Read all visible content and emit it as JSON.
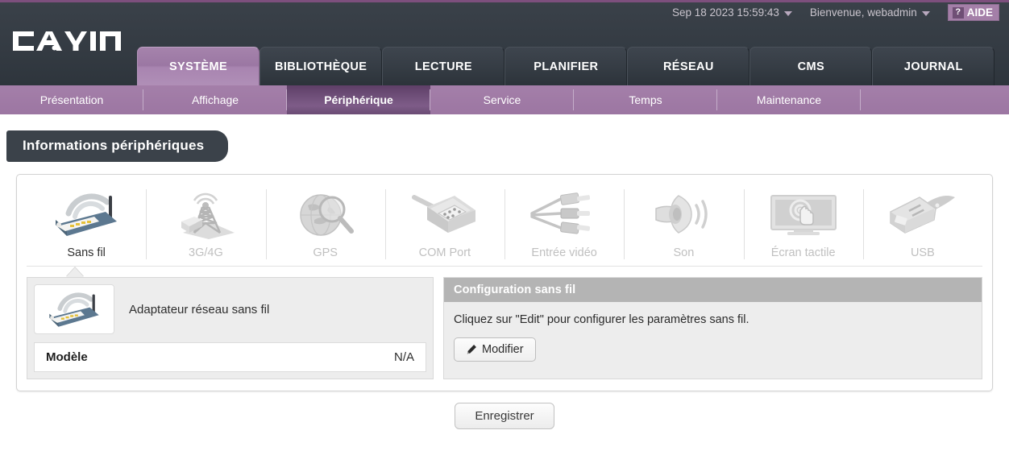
{
  "topbar": {
    "datetime": "Sep 18 2023 15:59:43",
    "welcome": "Bienvenue, webadmin",
    "help_label": "AIDE",
    "help_glyph": "?"
  },
  "brand": {
    "name": "CAYIN"
  },
  "main_tabs": [
    {
      "label": "SYSTÈME",
      "active": true
    },
    {
      "label": "BIBLIOTHÈQUE",
      "active": false
    },
    {
      "label": "LECTURE",
      "active": false
    },
    {
      "label": "PLANIFIER",
      "active": false
    },
    {
      "label": "RÉSEAU",
      "active": false
    },
    {
      "label": "CMS",
      "active": false
    },
    {
      "label": "JOURNAL",
      "active": false
    }
  ],
  "sub_tabs": [
    {
      "label": "Présentation",
      "active": false
    },
    {
      "label": "Affichage",
      "active": false
    },
    {
      "label": "Périphérique",
      "active": true
    },
    {
      "label": "Service",
      "active": false
    },
    {
      "label": "Temps",
      "active": false
    },
    {
      "label": "Maintenance",
      "active": false
    }
  ],
  "page": {
    "title": "Informations périphériques"
  },
  "devices": [
    {
      "label": "Sans fil",
      "icon": "wireless-router-icon",
      "active": true
    },
    {
      "label": "3G/4G",
      "icon": "cell-tower-icon",
      "active": false
    },
    {
      "label": "GPS",
      "icon": "globe-magnifier-icon",
      "active": false
    },
    {
      "label": "COM Port",
      "icon": "serial-connector-icon",
      "active": false
    },
    {
      "label": "Entrée vidéo",
      "icon": "rca-cables-icon",
      "active": false
    },
    {
      "label": "Son",
      "icon": "speaker-icon",
      "active": false
    },
    {
      "label": "Écran tactile",
      "icon": "touchscreen-icon",
      "active": false
    },
    {
      "label": "USB",
      "icon": "usb-connector-icon",
      "active": false
    }
  ],
  "adapter": {
    "name": "Adaptateur réseau sans fil",
    "model_key": "Modèle",
    "model_value": "N/A"
  },
  "config": {
    "header": "Configuration sans fil",
    "description": "Cliquez sur \"Edit\" pour configurer les paramètres sans fil.",
    "edit_label": "Modifier"
  },
  "footer": {
    "save_label": "Enregistrer"
  },
  "colors": {
    "accent_purple": "#a47fa9",
    "accent_purple_dark": "#6b4c75",
    "header_dark": "#343b43",
    "panel_gray": "#ededed",
    "panel_header_gray": "#b4b4b4"
  }
}
